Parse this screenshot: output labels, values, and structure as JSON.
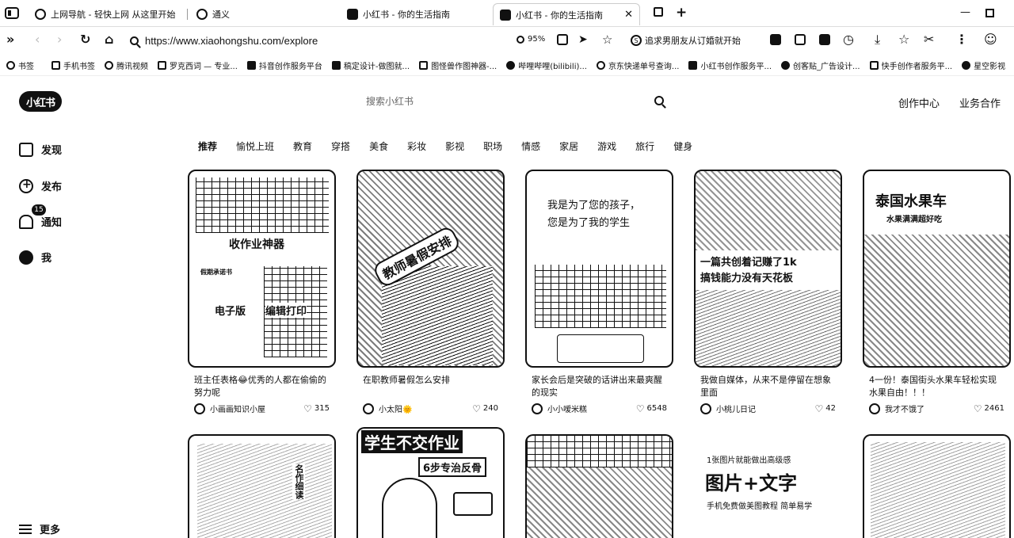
{
  "browser": {
    "tabs": [
      {
        "label": "上网导航 - 轻快上网 从这里开始"
      },
      {
        "label": "通义"
      },
      {
        "label": "小红书 - 你的生活指南"
      },
      {
        "label": "小红书 - 你的生活指南",
        "active": true
      }
    ],
    "url": "https://www.xiaohongshu.com/explore",
    "zoom": "95%",
    "trending": "追求男朋友从订婚就开始"
  },
  "bookmarks": [
    {
      "label": "书签"
    },
    {
      "label": "手机书签"
    },
    {
      "label": "腾讯视频"
    },
    {
      "label": "罗克西词 — 专业..."
    },
    {
      "label": "抖音创作服务平台"
    },
    {
      "label": "稿定设计-做图就..."
    },
    {
      "label": "图怪兽作图神器-..."
    },
    {
      "label": "哔哩哔哩(bilibili)..."
    },
    {
      "label": "京东快递单号查询..."
    },
    {
      "label": "小红书创作服务平..."
    },
    {
      "label": "创客贴_广告设计..."
    },
    {
      "label": "快手创作者服务平..."
    },
    {
      "label": "星空影视"
    }
  ],
  "site": {
    "logo": "小红书",
    "search_placeholder": "搜索小红书",
    "creator_center": "创作中心",
    "business": "业务合作"
  },
  "sidebar": {
    "items": [
      {
        "label": "发现",
        "icon": "home-icon"
      },
      {
        "label": "发布",
        "icon": "plus-icon"
      },
      {
        "label": "通知",
        "icon": "bell-icon"
      },
      {
        "label": "我",
        "icon": "avatar-icon"
      }
    ],
    "notification_count": "15",
    "more": "更多"
  },
  "channels": [
    "推荐",
    "愉悦上班",
    "教育",
    "穿搭",
    "美食",
    "彩妆",
    "影视",
    "职场",
    "情感",
    "家居",
    "游戏",
    "旅行",
    "健身"
  ],
  "cards": [
    {
      "cover_texts": [
        "收作业神器",
        "电子版",
        "编辑打印",
        "假期承诺书"
      ],
      "title": "班主任表格😂优秀的人都在偷偷的努力呢",
      "author": "小画画知识小屋",
      "likes": "315"
    },
    {
      "cover_texts": [
        "教师暑假安排"
      ],
      "title": "在职教师暑假怎么安排",
      "author": "小太阳🌞",
      "likes": "240"
    },
    {
      "cover_texts": [
        "我是为了您的孩子，",
        "您是为了我的学生"
      ],
      "title": "家长会后是突破的话讲出来最爽醒的现实",
      "author": "小小嗳米糕",
      "likes": "6548"
    },
    {
      "cover_texts": [
        "一篇共创着记赚了1k",
        "搞钱能力没有天花板"
      ],
      "title": "我做自媒体，从来不是停留在想象里面",
      "author": "小桃儿日记",
      "likes": "42"
    },
    {
      "cover_texts": [
        "泰国水果车",
        "水果满满超好吃"
      ],
      "title": "4一份！泰国街头水果车轻松实现水果自由！！！",
      "author": "我才不饿了",
      "likes": "2461"
    }
  ],
  "cards_row2": [
    {
      "cover_texts": [
        "名作细读"
      ]
    },
    {
      "cover_texts": [
        "学生不交作业",
        "6步专治反骨"
      ]
    },
    {
      "cover_texts": []
    },
    {
      "cover_texts": [
        "1张图片就能做出高级感",
        "图片+文字",
        "手机免费做美图教程  简单易学"
      ]
    },
    {
      "cover_texts": []
    }
  ]
}
